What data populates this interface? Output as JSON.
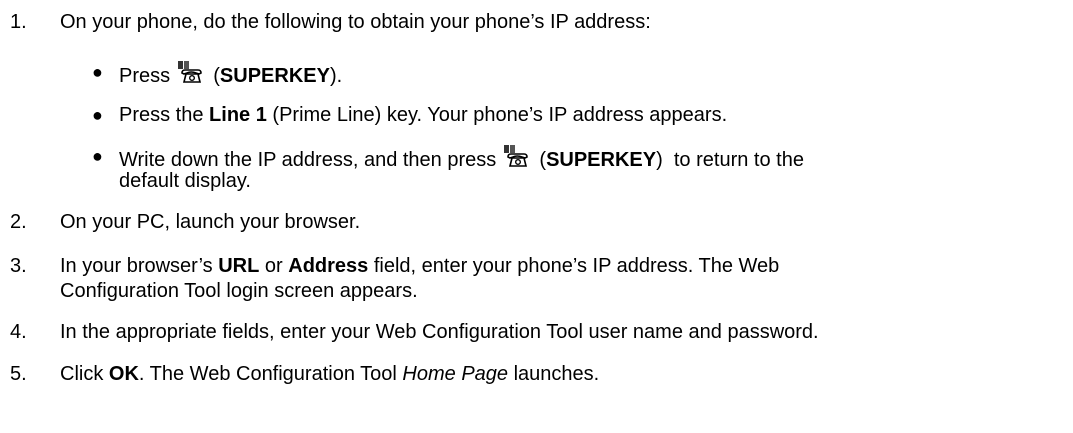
{
  "steps": [
    {
      "number": "1.",
      "text": "On your phone, do the following to obtain your phone’s IP address:",
      "substeps": [
        {
          "pre": "Press",
          "icon": "superkey-phone-icon",
          "open": "(",
          "bold": "SUPERKEY",
          "close": ")."
        },
        {
          "pre": "Press the",
          "bold": "Line 1",
          "post": "(Prime Line) key. Your phone’s IP address appears."
        },
        {
          "pre": "Write down the IP address, and then press",
          "icon": "superkey-phone-icon",
          "open": "(",
          "bold": "SUPERKEY",
          "close": ")  to return to the",
          "cont": "default display."
        }
      ]
    },
    {
      "number": "2.",
      "text": "On your PC, launch your browser."
    },
    {
      "number": "3.",
      "pre": "In your browser’s",
      "bold1": "URL",
      "mid": "or",
      "bold2": "Address",
      "post": "field, enter your phone’s IP address. The Web",
      "cont": "Configuration Tool login screen appears."
    },
    {
      "number": "4.",
      "text": "In the appropriate fields, enter your Web Configuration Tool user name and password."
    },
    {
      "number": "5.",
      "pre": "Click",
      "bold": "OK",
      "mid": ". The Web Configuration Tool",
      "italic": "Home Page",
      "post": "launches."
    }
  ]
}
